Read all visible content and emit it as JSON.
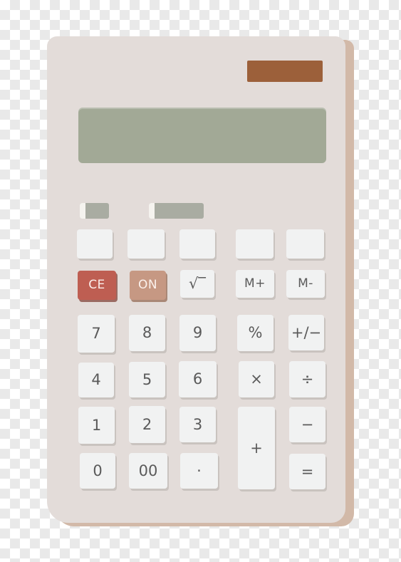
{
  "colors": {
    "body": "#e3dcd9",
    "body_shadow": "#d2b9a8",
    "solar_panel": "#9c603a",
    "display": "#a2a996",
    "key": "#f1f2f2",
    "key_text": "#5a5a5a",
    "ce_key": "#be5e52",
    "on_key": "#c69883"
  },
  "calculator": {
    "display_text": "",
    "keys": {
      "blank1": "",
      "blank2": "",
      "blank3": "",
      "blank4": "",
      "blank5": "",
      "ce": "CE",
      "on": "ON",
      "sqrt": "√‾",
      "m_plus": "M+",
      "m_minus": "M-",
      "seven": "7",
      "eight": "8",
      "nine": "9",
      "percent": "%",
      "plus_minus": "+/−",
      "four": "4",
      "five": "5",
      "six": "6",
      "multiply": "×",
      "divide": "÷",
      "one": "1",
      "two": "2",
      "three": "3",
      "plus": "+",
      "minus": "−",
      "zero": "0",
      "double_zero": "00",
      "decimal": "·",
      "equals": "="
    }
  }
}
